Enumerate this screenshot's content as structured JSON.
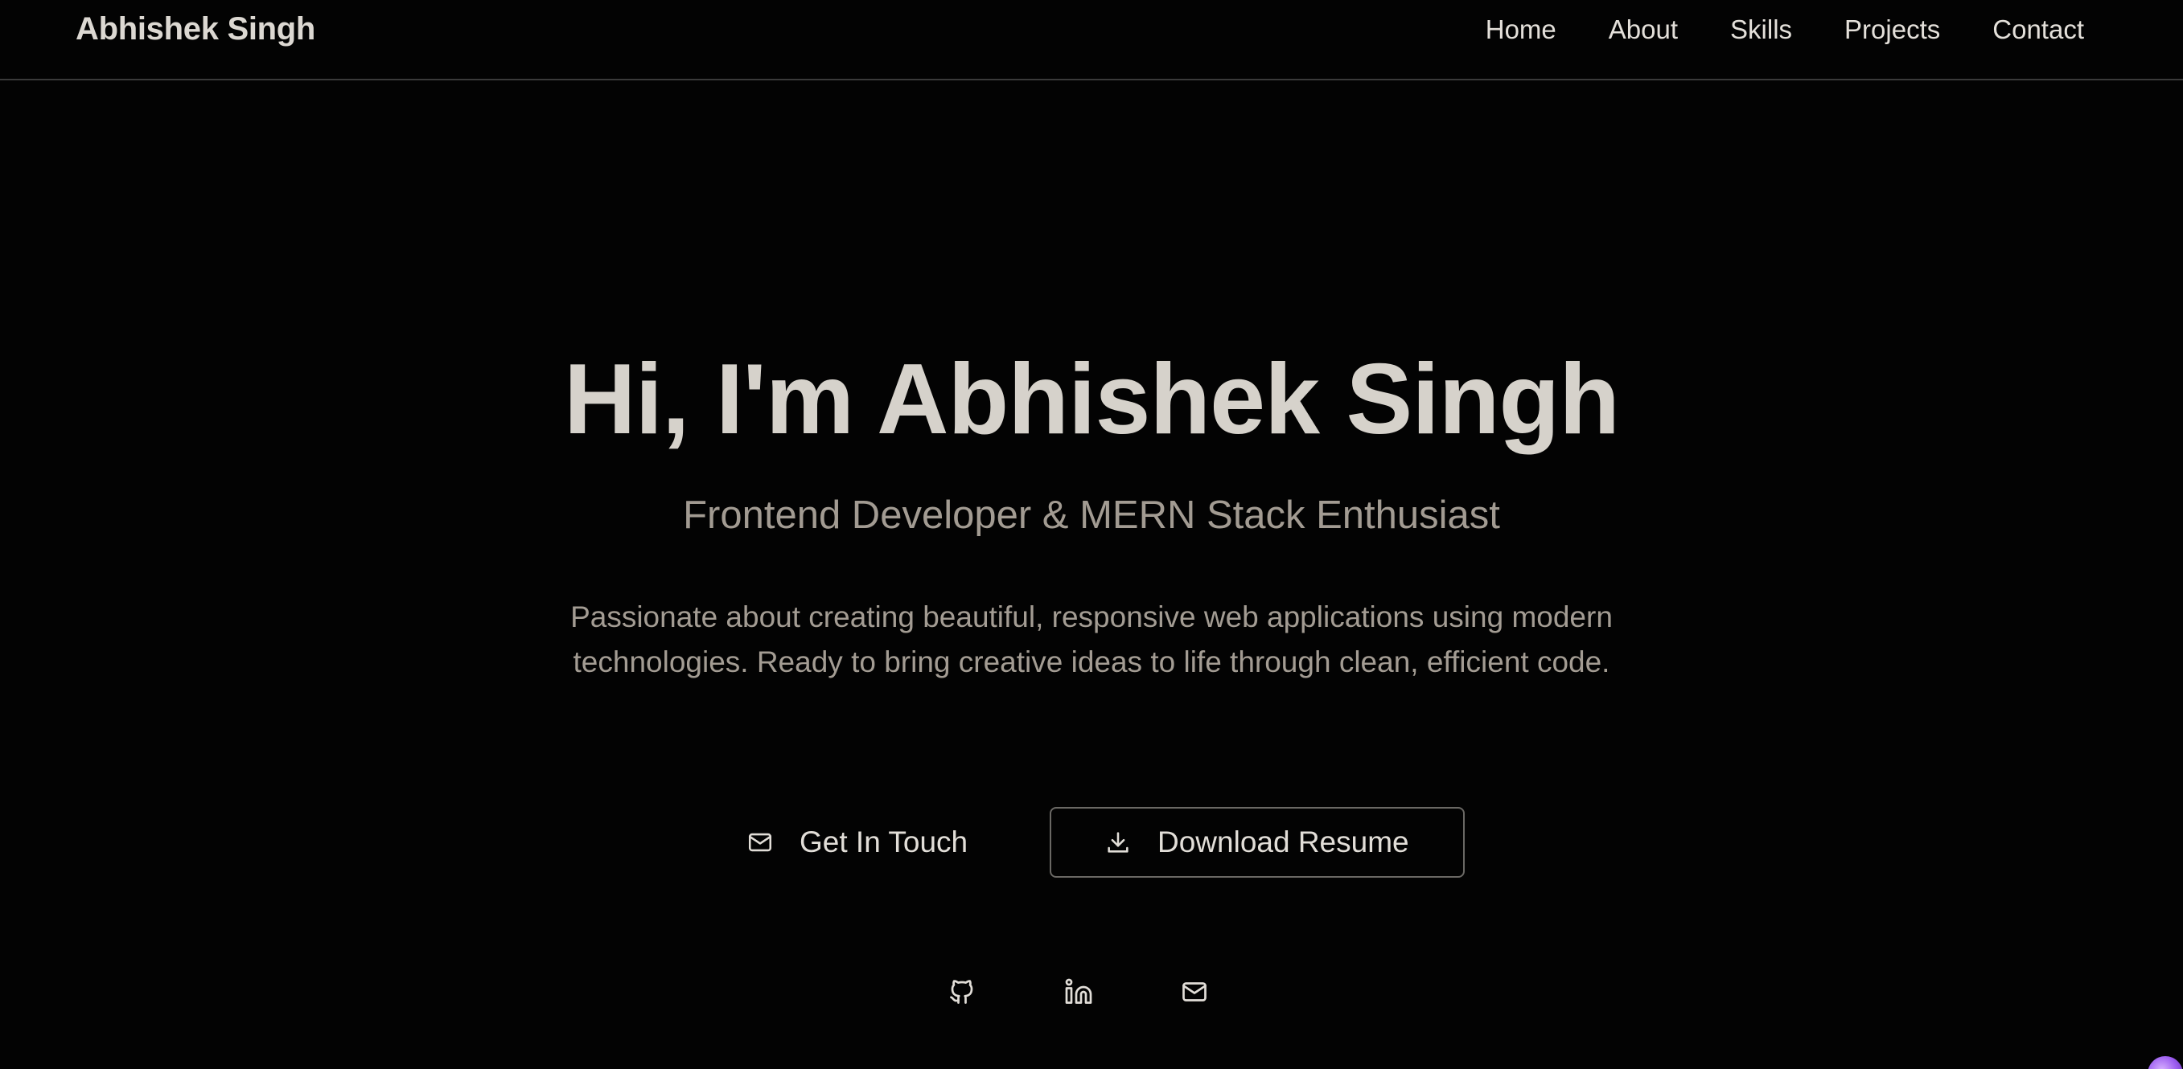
{
  "navbar": {
    "brand": "Abhishek Singh",
    "links": [
      "Home",
      "About",
      "Skills",
      "Projects",
      "Contact"
    ]
  },
  "hero": {
    "title": "Hi, I'm Abhishek Singh",
    "subtitle": "Frontend Developer & MERN Stack Enthusiast",
    "description": "Passionate about creating beautiful, responsive web applications using modern technologies. Ready to bring creative ideas to life through clean, efficient code.",
    "buttons": {
      "get_in_touch": "Get In Touch",
      "download_resume": "Download Resume"
    },
    "social_icons": [
      "github-icon",
      "linkedin-icon",
      "mail-icon"
    ]
  },
  "colors": {
    "background": "#030303",
    "title": "#d6d2cb",
    "muted_text": "#a29b92",
    "nav_text": "#e4e0da",
    "border": "#6a6864"
  }
}
